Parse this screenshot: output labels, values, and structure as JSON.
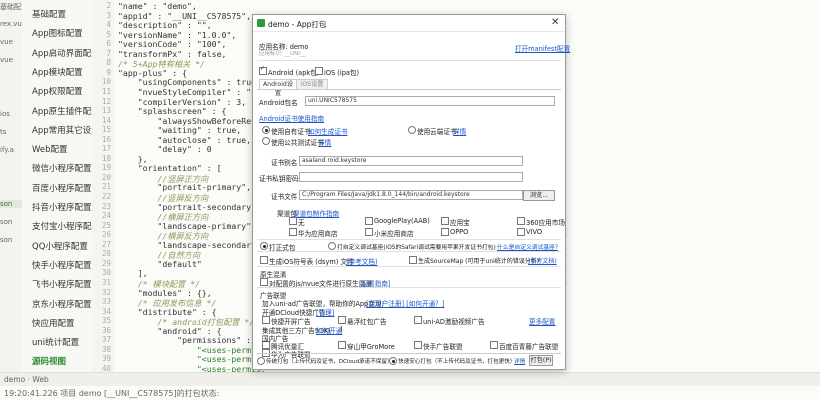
{
  "explorer": {
    "items": [
      "基础配置",
      "rex.vue",
      "vue",
      "vue",
      "",
      "",
      "ios",
      "ts",
      "ify.a",
      "",
      "",
      "son",
      "son",
      "son",
      "",
      "",
      "",
      ""
    ]
  },
  "nav": {
    "items": [
      "基础配置",
      "App图标配置",
      "App启动界面配置",
      "App模块配置",
      "App权限配置",
      "App原生插件配置",
      "App常用其它设置",
      "Web配置",
      "微信小程序配置",
      "百度小程序配置",
      "抖音小程序配置",
      "支付宝小程序配置",
      "QQ小程序配置",
      "快手小程序配置",
      "飞书小程序配置",
      "京东小程序配置",
      "快应用配置",
      "uni统计配置",
      "源码视图"
    ]
  },
  "code": {
    "line_numbers": [
      "2",
      "3",
      "4",
      "5",
      "6",
      "7",
      "8",
      "9",
      "10",
      "11",
      "12",
      "13",
      "14",
      "15",
      "16",
      "17",
      "18",
      "19",
      "20",
      "21",
      "22",
      "23",
      "24",
      "25",
      "26",
      "27",
      "28",
      "29",
      "30",
      "31",
      "32",
      "33",
      "34",
      "35",
      "36",
      "37",
      "38",
      "39",
      "40"
    ],
    "lines": [
      "\"name\" : \"demo\",",
      "\"appid\" : \"__UNI__C578575\",",
      "\"description\" : \"\",",
      "\"versionName\" : \"1.0.0\",",
      "\"versionCode\" : \"100\",",
      "\"transformPx\" : false,",
      "/* 5+App特有相关 */",
      "\"app-plus\" : {",
      "    \"usingComponents\" : true,",
      "    \"nvueStyleCompiler\" : \"uni-app\",",
      "    \"compilerVersion\" : 3,",
      "    \"splashscreen\" : {",
      "        \"alwaysShowBeforeRender\" :",
      "        \"waiting\" : true,",
      "        \"autoclose\" : true,",
      "        \"delay\" : 0",
      "    },",
      "    \"orientation\" : [",
      "        //竖屏正方向",
      "        \"portrait-primary\",",
      "        //竖屏反方向",
      "        \"portrait-secondary\",",
      "        //横屏正方向",
      "        \"landscape-primary\",",
      "        //横屏反方向",
      "        \"landscape-secondary\",",
      "        //自然方向",
      "        \"default\"",
      "    ],",
      "    /* 模块配置 */",
      "    \"modules\" : {},",
      "    /* 应用发布信息 */",
      "    \"distribute\" : {",
      "        /* android打包配置 */",
      "        \"android\" : {",
      "            \"permissions\" : [",
      "                \"<uses-permission",
      "                \"<uses-permission",
      "                \"<uses-permission"
    ]
  },
  "status": {
    "left": "demo · Web",
    "console": "19:20:41.226 项目 demo [__UNI__C578575]的打包状态:"
  },
  "dialog": {
    "title": "demo - App打包",
    "app_name_label": "应用名称: demo",
    "appid_label": "应用标识: __UNI__",
    "manifest_link": "打开manifest配置",
    "android_cb": "Android (apk包)",
    "ios_cb": "iOS (ipa包)",
    "tab_android": "Android设置",
    "tab_ios": "iOS设置",
    "pkg_label": "Android包名",
    "pkg_value": "uni.UNIC578575",
    "cert_link": "Android证书使用指南",
    "radio_own": "使用自有证书",
    "radio_own_link": "如何生成证书",
    "radio_cloud": "使用云端证书",
    "radio_cloud_link": "详情",
    "radio_public": "使用公共测试证书",
    "radio_public_link": "详情",
    "alias_label": "证书别名",
    "alias_value": "asaland roid.keystore",
    "pwd_label": "证书私钥密码",
    "file_label": "证书文件",
    "file_value": "C:/Program Files/Java/jdk1.8.0_144/bin/android.keystore",
    "browse": "浏览...",
    "channel_label": "渠道包",
    "channel_link": "渠道包制作指南",
    "channels": [
      "无",
      "GooglePlay(AAB)",
      "应用宝",
      "360应用市场",
      "华为应用商店",
      "小米应用商店",
      "OPPO",
      "VIVO"
    ],
    "pack_formal": "打正式包",
    "pack_custom": "打自定义调试基座(iOS的Safari调试需要用苹果开发证书打包)",
    "pack_custom_link": "什么是自定义调试基座?",
    "gen_sourcemap": "生成iOS符号表 (dsym) 文件",
    "gen_sourcemap_link": "(参考文档)",
    "gen_sourcemap2": "生成SourceMap (可用于uni统计的错误分析)",
    "gen_sourcemap2_link": "(参考文档)",
    "native_label": "原生混淆",
    "native_cb": "对配置的js/nvue文件进行原生混淆",
    "native_link": "[配置指南]",
    "ad_label": "广告联盟",
    "ad_line1": "加入uni-ad广告联盟，帮助你的App变现:",
    "ad_line1_link": "[新用户注册] [如何开通？]",
    "ad_line2": "开通DCloud快捷广告:",
    "ad_line2_link": "[管理]",
    "ad_opts": [
      "快捷开屏广告",
      "悬浮红包广告",
      "uni-AD激励视频广告"
    ],
    "ad_more": "更多配置",
    "ad_third": "集成其他三方广告SDK(",
    "ad_third_link": "如何开通",
    "ad_third_end": ")",
    "ad_domestic": "国内广告",
    "ad_opts2": [
      "腾讯优量汇",
      "穿山甲GroMore",
      "快手广告联盟",
      "百度百青藤广告联盟"
    ],
    "ad_opts3": [
      "华为广告联盟"
    ],
    "foot_traditional": "传统打包（上传代码及证书，DCloud承诺不保留）",
    "foot_fast": "快速安心打包（不上传代码及证书，打包更快）",
    "foot_link": "详情",
    "pack_btn": "打包(P)",
    "cancel_btn": "取消"
  }
}
